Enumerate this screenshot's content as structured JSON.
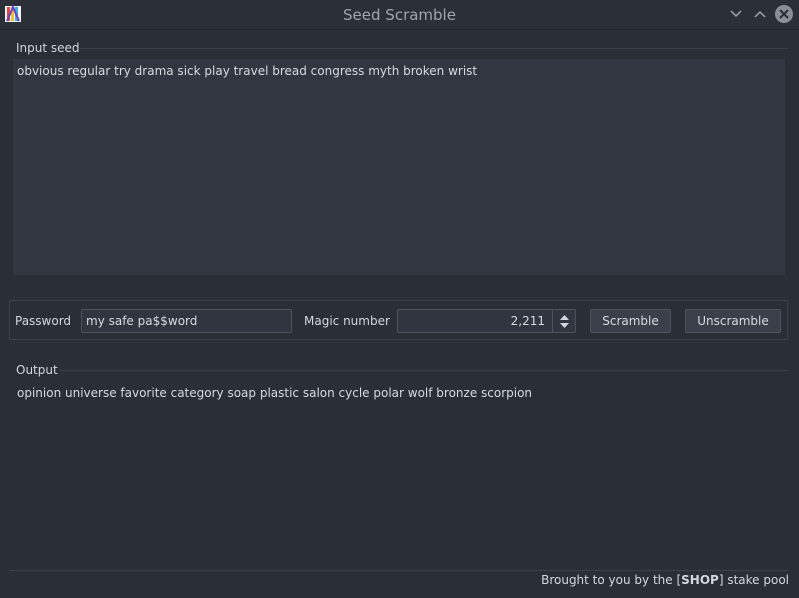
{
  "window": {
    "title": "Seed Scramble",
    "logo_icon": "colorful-app-logo-icon",
    "controls": [
      "chevron-down-icon",
      "chevron-up-icon",
      "close-icon"
    ]
  },
  "input_section": {
    "label": "Input seed",
    "value": "obvious regular try drama sick play travel bread congress myth broken wrist"
  },
  "controls": {
    "password_label": "Password",
    "password_value": "my safe pa$$word",
    "magic_label": "Magic number",
    "magic_value": "2,211",
    "scramble_label": "Scramble",
    "unscramble_label": "Unscramble"
  },
  "output_section": {
    "label": "Output",
    "value": "opinion universe favorite category soap plastic salon cycle polar wolf bronze scorpion"
  },
  "footer": {
    "prefix": "Brought to you by the [",
    "pool": "SHOP",
    "suffix": "] stake pool"
  }
}
